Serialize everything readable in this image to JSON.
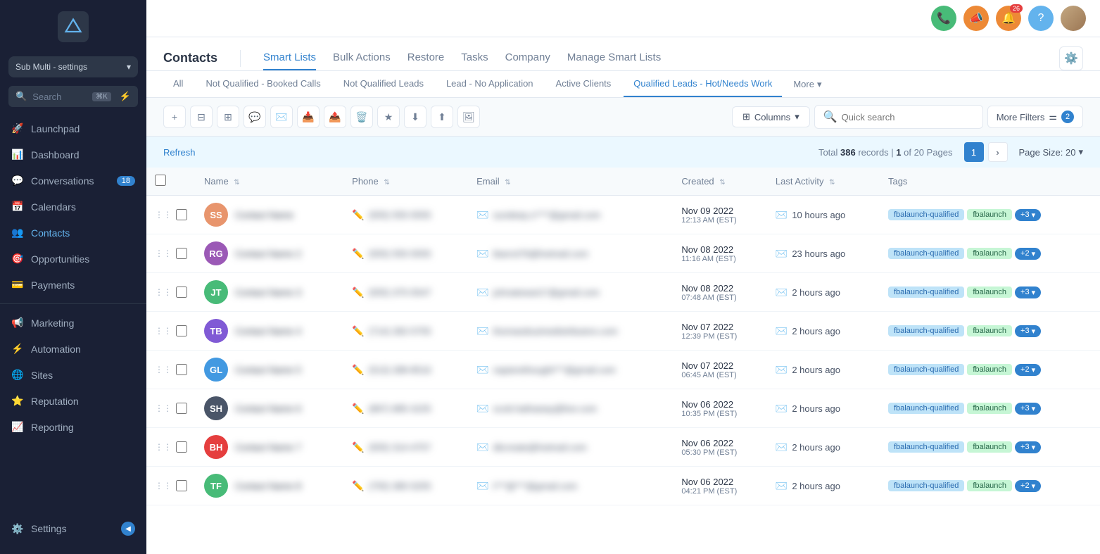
{
  "sidebar": {
    "account": "Sub Multi - settings",
    "nav_items": [
      {
        "id": "launchpad",
        "label": "Launchpad",
        "icon": "🚀",
        "badge": null
      },
      {
        "id": "dashboard",
        "label": "Dashboard",
        "icon": "📊",
        "badge": null
      },
      {
        "id": "conversations",
        "label": "Conversations",
        "icon": "💬",
        "badge": "18"
      },
      {
        "id": "calendars",
        "label": "Calendars",
        "icon": "📅",
        "badge": null
      },
      {
        "id": "contacts",
        "label": "Contacts",
        "icon": "👥",
        "badge": null
      },
      {
        "id": "opportunities",
        "label": "Opportunities",
        "icon": "🎯",
        "badge": null
      },
      {
        "id": "payments",
        "label": "Payments",
        "icon": "💳",
        "badge": null
      },
      {
        "id": "marketing",
        "label": "Marketing",
        "icon": "📢",
        "badge": null
      },
      {
        "id": "automation",
        "label": "Automation",
        "icon": "⚡",
        "badge": null
      },
      {
        "id": "sites",
        "label": "Sites",
        "icon": "🌐",
        "badge": null
      },
      {
        "id": "reputation",
        "label": "Reputation",
        "icon": "⭐",
        "badge": null
      },
      {
        "id": "reporting",
        "label": "Reporting",
        "icon": "📈",
        "badge": null
      }
    ],
    "settings": "Settings",
    "search_placeholder": "Search",
    "search_kbd": "⌘K"
  },
  "topbar": {
    "icons": [
      {
        "id": "phone",
        "symbol": "📞",
        "color": "green",
        "badge": null
      },
      {
        "id": "megaphone",
        "symbol": "📣",
        "color": "orange",
        "badge": null
      },
      {
        "id": "bell",
        "symbol": "🔔",
        "color": "orange",
        "badge": "26"
      },
      {
        "id": "help",
        "symbol": "❓",
        "color": "blue",
        "badge": null
      }
    ]
  },
  "page": {
    "title": "Contacts",
    "tabs": [
      {
        "id": "smart-lists",
        "label": "Smart Lists"
      },
      {
        "id": "bulk-actions",
        "label": "Bulk Actions"
      },
      {
        "id": "restore",
        "label": "Restore"
      },
      {
        "id": "tasks",
        "label": "Tasks"
      },
      {
        "id": "company",
        "label": "Company"
      },
      {
        "id": "manage-smart-lists",
        "label": "Manage Smart Lists"
      }
    ],
    "active_tab": "smart-lists"
  },
  "smartlist_tabs": [
    {
      "id": "all",
      "label": "All"
    },
    {
      "id": "not-qualified-booked",
      "label": "Not Qualified - Booked Calls"
    },
    {
      "id": "not-qualified-leads",
      "label": "Not Qualified Leads"
    },
    {
      "id": "lead-no-app",
      "label": "Lead - No Application"
    },
    {
      "id": "active-clients",
      "label": "Active Clients"
    },
    {
      "id": "qualified-leads",
      "label": "Qualified Leads - Hot/Needs Work"
    },
    {
      "id": "more",
      "label": "More"
    }
  ],
  "active_smartlist": "qualified-leads",
  "toolbar": {
    "add_label": "+",
    "columns_label": "Columns",
    "search_placeholder": "Quick search",
    "more_filters_label": "More Filters",
    "filter_count": "2"
  },
  "table": {
    "refresh_label": "Refresh",
    "total_records": "386",
    "page_info": "1 of 20 Pages",
    "page_size_label": "Page Size: 20",
    "columns": [
      "Name",
      "Phone",
      "Email",
      "Created",
      "Last Activity",
      "Tags"
    ],
    "rows": [
      {
        "id": 1,
        "avatar_color": "#e8956d",
        "avatar_initials": "SS",
        "name": "Contact Name",
        "phone": "(555) 555-5555",
        "email": "sundeep.s****@gmail.com",
        "created_date": "Nov 09 2022",
        "created_time": "12:13 AM (EST)",
        "last_activity": "10 hours ago",
        "tags": [
          "fbalaunch-qualified",
          "fbalaunch"
        ],
        "extra_tags": "+3"
      },
      {
        "id": 2,
        "avatar_color": "#9b59b6",
        "avatar_initials": "RG",
        "name": "Contact Name 2",
        "phone": "(555) 555-5555",
        "email": "tbarrot76@hotmail.com",
        "created_date": "Nov 08 2022",
        "created_time": "11:16 AM (EST)",
        "last_activity": "23 hours ago",
        "tags": [
          "fbalaunch-qualified",
          "fbalaunch"
        ],
        "extra_tags": "+2"
      },
      {
        "id": 3,
        "avatar_color": "#48bb78",
        "avatar_initials": "JT",
        "name": "Contact Name 3",
        "phone": "(555) 375-5547",
        "email": "johnatewari1*@gmail.com",
        "created_date": "Nov 08 2022",
        "created_time": "07:48 AM (EST)",
        "last_activity": "2 hours ago",
        "tags": [
          "fbalaunch-qualified",
          "fbalaunch"
        ],
        "extra_tags": "+3"
      },
      {
        "id": 4,
        "avatar_color": "#805ad5",
        "avatar_initials": "TB",
        "name": "Contact Name 4",
        "phone": "(714) 282-5755",
        "email": "thomasdouimedistributors.com",
        "created_date": "Nov 07 2022",
        "created_time": "12:39 PM (EST)",
        "last_activity": "2 hours ago",
        "tags": [
          "fbalaunch-qualified",
          "fbalaunch"
        ],
        "extra_tags": "+3"
      },
      {
        "id": 5,
        "avatar_color": "#4299e1",
        "avatar_initials": "GL",
        "name": "Contact Name 5",
        "phone": "(513) 288-8516",
        "email": "napierethought***@gmail.com",
        "created_date": "Nov 07 2022",
        "created_time": "06:45 AM (EST)",
        "last_activity": "2 hours ago",
        "tags": [
          "fbalaunch-qualified",
          "fbalaunch"
        ],
        "extra_tags": "+2"
      },
      {
        "id": 6,
        "avatar_color": "#4a5568",
        "avatar_initials": "SH",
        "name": "Contact Name 6",
        "phone": "(897) 885-3155",
        "email": "scott.hathaway@live.com",
        "created_date": "Nov 06 2022",
        "created_time": "10:35 PM (EST)",
        "last_activity": "2 hours ago",
        "tags": [
          "fbalaunch-qualified",
          "fbalaunch"
        ],
        "extra_tags": "+3"
      },
      {
        "id": 7,
        "avatar_color": "#e53e3e",
        "avatar_initials": "BH",
        "name": "Contact Name 7",
        "phone": "(555) 314-4757",
        "email": "dkcreate@hotmail.com",
        "created_date": "Nov 06 2022",
        "created_time": "05:30 PM (EST)",
        "last_activity": "2 hours ago",
        "tags": [
          "fbalaunch-qualified",
          "fbalaunch"
        ],
        "extra_tags": "+3"
      },
      {
        "id": 8,
        "avatar_color": "#48bb78",
        "avatar_initials": "TF",
        "name": "Contact Name 8",
        "phone": "(755) 385-5255",
        "email": "t***@***@gmail.com",
        "created_date": "Nov 06 2022",
        "created_time": "04:21 PM (EST)",
        "last_activity": "2 hours ago",
        "tags": [
          "fbalaunch-qualified",
          "fbalaunch"
        ],
        "extra_tags": "+2"
      }
    ]
  }
}
